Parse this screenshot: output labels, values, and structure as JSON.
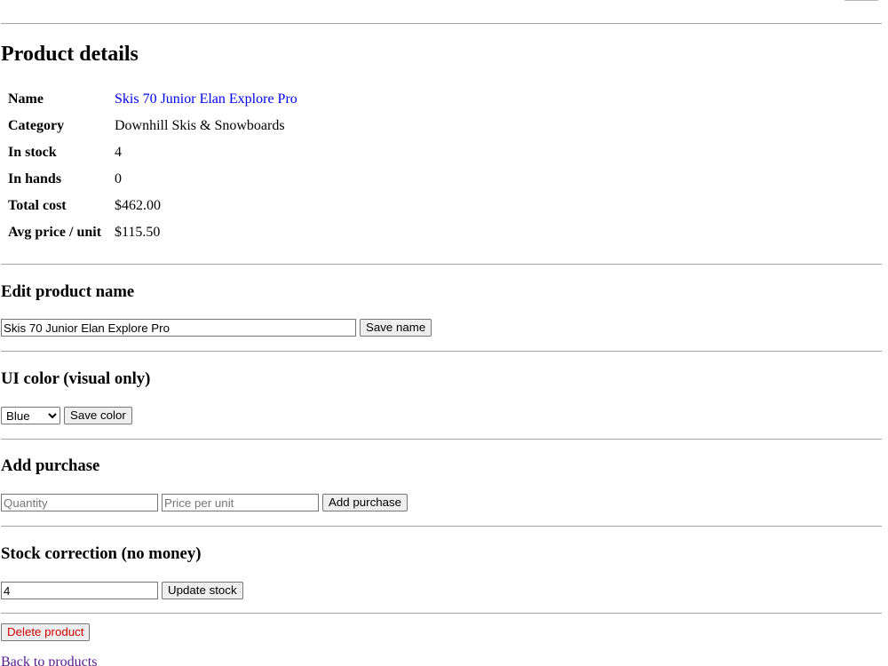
{
  "details": {
    "title": "Product details",
    "rows": [
      {
        "label": "Name",
        "value": "Skis 70 Junior Elan Explore Pro"
      },
      {
        "label": "Category",
        "value": "Downhill Skis & Snowboards"
      },
      {
        "label": "In stock",
        "value": "4"
      },
      {
        "label": "In hands",
        "value": "0"
      },
      {
        "label": "Total cost",
        "value": "$462.00"
      },
      {
        "label": "Avg price / unit",
        "value": "$115.50"
      }
    ]
  },
  "edit_name": {
    "heading": "Edit product name",
    "input_value": "Skis 70 Junior Elan Explore Pro",
    "button": "Save name"
  },
  "ui_color": {
    "heading": "UI color (visual only)",
    "selected": "Blue",
    "button": "Save color"
  },
  "purchase": {
    "heading": "Add purchase",
    "quantity_placeholder": "Quantity",
    "price_placeholder": "Price per unit",
    "button": "Add purchase"
  },
  "stock": {
    "heading": "Stock correction (no money)",
    "input_value": "4",
    "button": "Update stock"
  },
  "actions": {
    "delete": "Delete product",
    "back": "Back to products"
  }
}
